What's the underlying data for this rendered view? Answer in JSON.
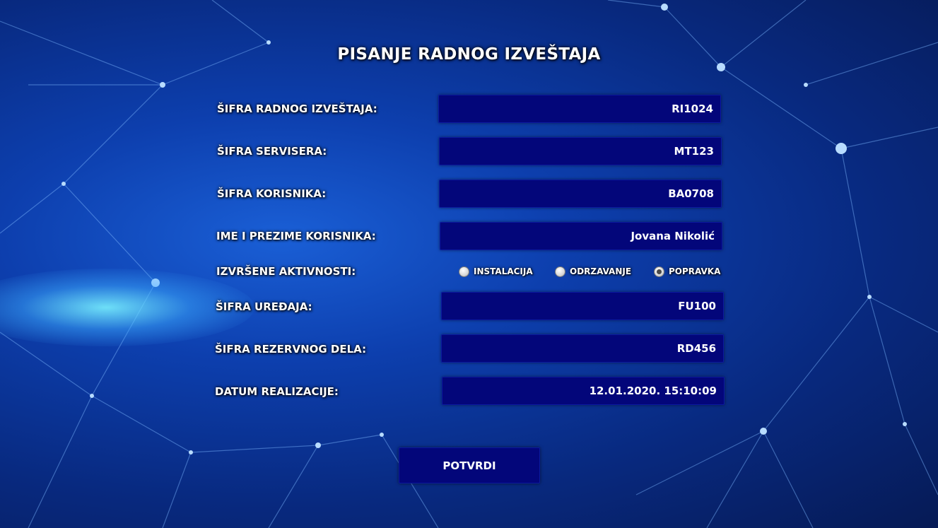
{
  "form": {
    "title": "PISANJE RADNOG IZVEŠTAJA",
    "fields": {
      "report_id": {
        "label": "ŠIFRA RADNOG IZVEŠTAJA:",
        "value": "RI1024"
      },
      "technician_id": {
        "label": "ŠIFRA SERVISERA:",
        "value": "MT123"
      },
      "user_id": {
        "label": "ŠIFRA KORISNIKA:",
        "value": "BA0708"
      },
      "user_name": {
        "label": "IME I PREZIME KORISNIKA:",
        "value": "Jovana Nikolić"
      },
      "device_id": {
        "label": "ŠIFRA UREĐAJA:",
        "value": "FU100"
      },
      "spare_part_id": {
        "label": "ŠIFRA REZERVNOG DELA:",
        "value": "RD456"
      },
      "realization_date": {
        "label": "DATUM REALIZACIJE:",
        "value": "12.01.2020. 15:10:09"
      }
    },
    "activities": {
      "label": "IZVRŠENE AKTIVNOSTI:",
      "options": [
        "INSTALACIJA",
        "ODRZAVANJE",
        "POPRAVKA"
      ],
      "selected": "POPRAVKA"
    },
    "submit_label": "POTVRDI"
  },
  "colors": {
    "field_background": "#03067a",
    "background": "#0d3fae"
  }
}
